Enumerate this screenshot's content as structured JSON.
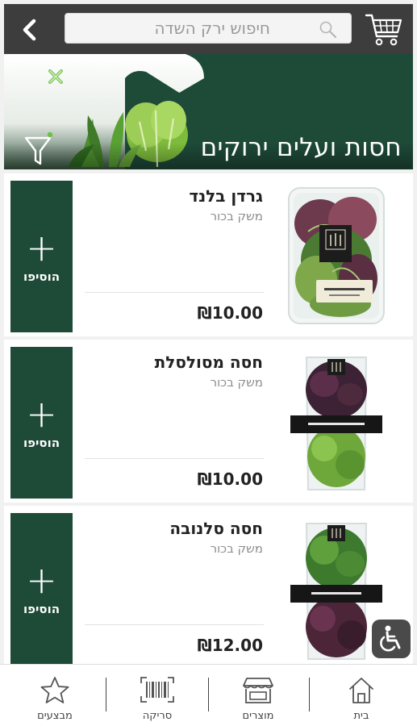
{
  "header": {
    "search_placeholder": "חיפוש ירק השדה",
    "icons": {
      "back": "chevron-left-icon",
      "search": "search-icon",
      "cart": "cart-icon"
    }
  },
  "banner": {
    "title": "חסות ועלים ירוקים",
    "icons": {
      "close": "close-icon",
      "filter": "filter-icon"
    },
    "colors": {
      "background": "#1e4a38"
    }
  },
  "products": [
    {
      "name": "גרדן בלנד",
      "farm": "משק בכור",
      "price": "₪10.00",
      "add_label": "הוסיפו",
      "add_symbol": "+"
    },
    {
      "name": "חסה מסולסלת",
      "farm": "משק בכור",
      "price": "₪10.00",
      "add_label": "הוסיפו",
      "add_symbol": "+"
    },
    {
      "name": "חסה סלנובה",
      "farm": "משק בכור",
      "price": "₪12.00",
      "add_label": "הוסיפו",
      "add_symbol": "+"
    }
  ],
  "bottom_nav": [
    {
      "label": "מבצעים",
      "icon": "star-icon"
    },
    {
      "label": "סריקה",
      "icon": "barcode-icon"
    },
    {
      "label": "מוצרים",
      "icon": "store-icon"
    },
    {
      "label": "בית",
      "icon": "home-icon"
    }
  ],
  "accessibility": {
    "icon": "wheelchair-icon"
  },
  "colors": {
    "primary": "#1e4a38",
    "topbar": "#3d3d3d",
    "accent_green": "#6ec043"
  }
}
